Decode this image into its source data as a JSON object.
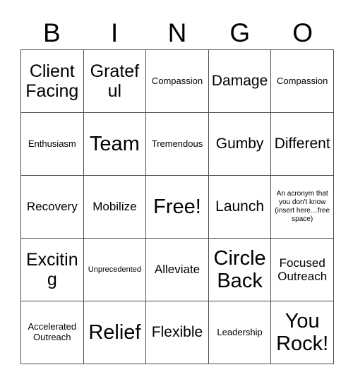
{
  "card": {
    "title": "BINGO",
    "header_letters": [
      "B",
      "I",
      "N",
      "G",
      "O"
    ],
    "rows": 5,
    "columns": 5,
    "border_color": "#4d4d4d",
    "background_color": "#ffffff",
    "text_color": "#000000",
    "cells": [
      {
        "text": "Client Facing",
        "size": "xl",
        "row": 1,
        "column": "B"
      },
      {
        "text": "Grateful",
        "size": "xl",
        "row": 1,
        "column": "I"
      },
      {
        "text": "Compassion",
        "size": "sm",
        "row": 1,
        "column": "N"
      },
      {
        "text": "Damage",
        "size": "lg",
        "row": 1,
        "column": "G"
      },
      {
        "text": "Compassion",
        "size": "sm",
        "row": 1,
        "column": "O"
      },
      {
        "text": "Enthusiasm",
        "size": "sm",
        "row": 2,
        "column": "B"
      },
      {
        "text": "Team",
        "size": "xxl",
        "row": 2,
        "column": "I"
      },
      {
        "text": "Tremendous",
        "size": "sm",
        "row": 2,
        "column": "N"
      },
      {
        "text": "Gumby",
        "size": "lg",
        "row": 2,
        "column": "G"
      },
      {
        "text": "Different",
        "size": "lg",
        "row": 2,
        "column": "O"
      },
      {
        "text": "Recovery",
        "size": "md",
        "row": 3,
        "column": "B"
      },
      {
        "text": "Mobilize",
        "size": "md",
        "row": 3,
        "column": "I"
      },
      {
        "text": "Free!",
        "size": "xxl",
        "row": 3,
        "column": "N"
      },
      {
        "text": "Launch",
        "size": "lg",
        "row": 3,
        "column": "G"
      },
      {
        "text": "An acronym that you don't know (insert here…free space)",
        "size": "xxs",
        "row": 3,
        "column": "O"
      },
      {
        "text": "Exciting",
        "size": "xl",
        "row": 4,
        "column": "B"
      },
      {
        "text": "Unprecedented",
        "size": "xs",
        "row": 4,
        "column": "I"
      },
      {
        "text": "Alleviate",
        "size": "md",
        "row": 4,
        "column": "N"
      },
      {
        "text": "Circle Back",
        "size": "xxl",
        "row": 4,
        "column": "G"
      },
      {
        "text": "Focused Outreach",
        "size": "md",
        "row": 4,
        "column": "O"
      },
      {
        "text": "Accelerated Outreach",
        "size": "sm",
        "row": 5,
        "column": "B"
      },
      {
        "text": "Relief",
        "size": "xxl",
        "row": 5,
        "column": "I"
      },
      {
        "text": "Flexible",
        "size": "lg",
        "row": 5,
        "column": "N"
      },
      {
        "text": "Leadership",
        "size": "sm",
        "row": 5,
        "column": "G"
      },
      {
        "text": "You Rock!",
        "size": "xxl",
        "row": 5,
        "column": "O"
      }
    ]
  }
}
